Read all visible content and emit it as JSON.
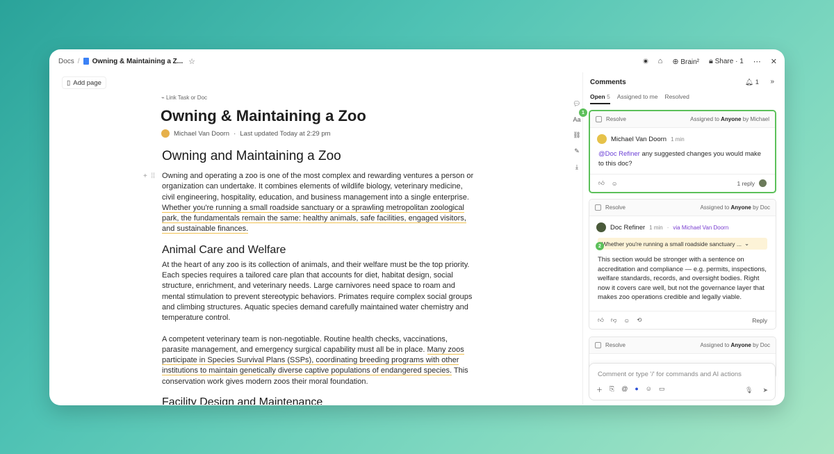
{
  "topbar": {
    "crumb_docs": "Docs",
    "crumb_title": "Owning & Maintaining a Z...",
    "brain_label": "Brain²",
    "share_label": "Share · 1"
  },
  "sidebar": {
    "add_page": "Add page"
  },
  "doc": {
    "link_task": "Link Task or Doc",
    "title": "Owning & Maintaining a Zoo",
    "author": "Michael Van Doorn",
    "updated": "Last updated Today at 2:29 pm",
    "h1": "Owning and Maintaining a Zoo",
    "p1_a": "Owning and operating a zoo is one of the most complex and rewarding ventures a person or organization can undertake. It combines elements of wildlife biology, veterinary medicine, civil engineering, hospitality, education, and business management into a single enterprise. ",
    "p1_b": "Whether you're running a small roadside sanctuary or a sprawling metropolitan zoological park, the fundamentals remain the same: healthy animals, safe facilities, engaged visitors, and sustainable finances.",
    "h2_1": "Animal Care and Welfare",
    "p2": "At the heart of any zoo is its collection of animals, and their welfare must be the top priority. Each species requires a tailored care plan that accounts for diet, habitat design, social structure, enrichment, and veterinary needs. Large carnivores need space to roam and mental stimulation to prevent stereotypic behaviors. Primates require complex social groups and climbing structures. Aquatic species demand carefully maintained water chemistry and temperature control.",
    "p3_a": "A competent veterinary team is non-negotiable. Routine health checks, vaccinations, parasite management, and emergency surgical capability must all be in place. ",
    "p3_b": "Many zoos participate in Species Survival Plans (SSPs), coordinating breeding programs with other institutions to maintain genetically diverse captive populations of endangered species.",
    "p3_c": " This conservation work gives modern zoos their moral foundation.",
    "h2_2": "Facility Design and Maintenance"
  },
  "comments": {
    "header": "Comments",
    "notif_count": "1",
    "tabs": {
      "open": "Open",
      "open_count": "5",
      "assigned": "Assigned to me",
      "resolved": "Resolved"
    },
    "card1": {
      "badge": "1",
      "resolve": "Resolve",
      "assigned_prefix": "Assigned to",
      "assignee": "Anyone",
      "by": "by Michael",
      "author": "Michael Van Doorn",
      "time": "1 min",
      "mention": "@Doc Refiner",
      "text": " any suggested changes you would make to this doc?",
      "replies": "1 reply"
    },
    "card2": {
      "badge": "2",
      "resolve": "Resolve",
      "assigned_prefix": "Assigned to",
      "assignee": "Anyone",
      "by": "by Doc",
      "author": "Doc Refiner",
      "time": "1 min",
      "via": "via Michael Van Doorn",
      "quote": "Whether you're running a small roadside sanctuary ...",
      "text": "This section would be stronger with a sentence on accreditation and compliance — e.g. permits, inspections, welfare standards, records, and oversight bodies. Right now it covers care well, but not the governance layer that makes zoo operations credible and legally viable.",
      "reply": "Reply"
    },
    "card3": {
      "resolve": "Resolve",
      "assigned_prefix": "Assigned to",
      "assignee": "Anyone",
      "by": "by Doc"
    },
    "input_placeholder": "Comment or type '/' for commands and AI actions"
  }
}
